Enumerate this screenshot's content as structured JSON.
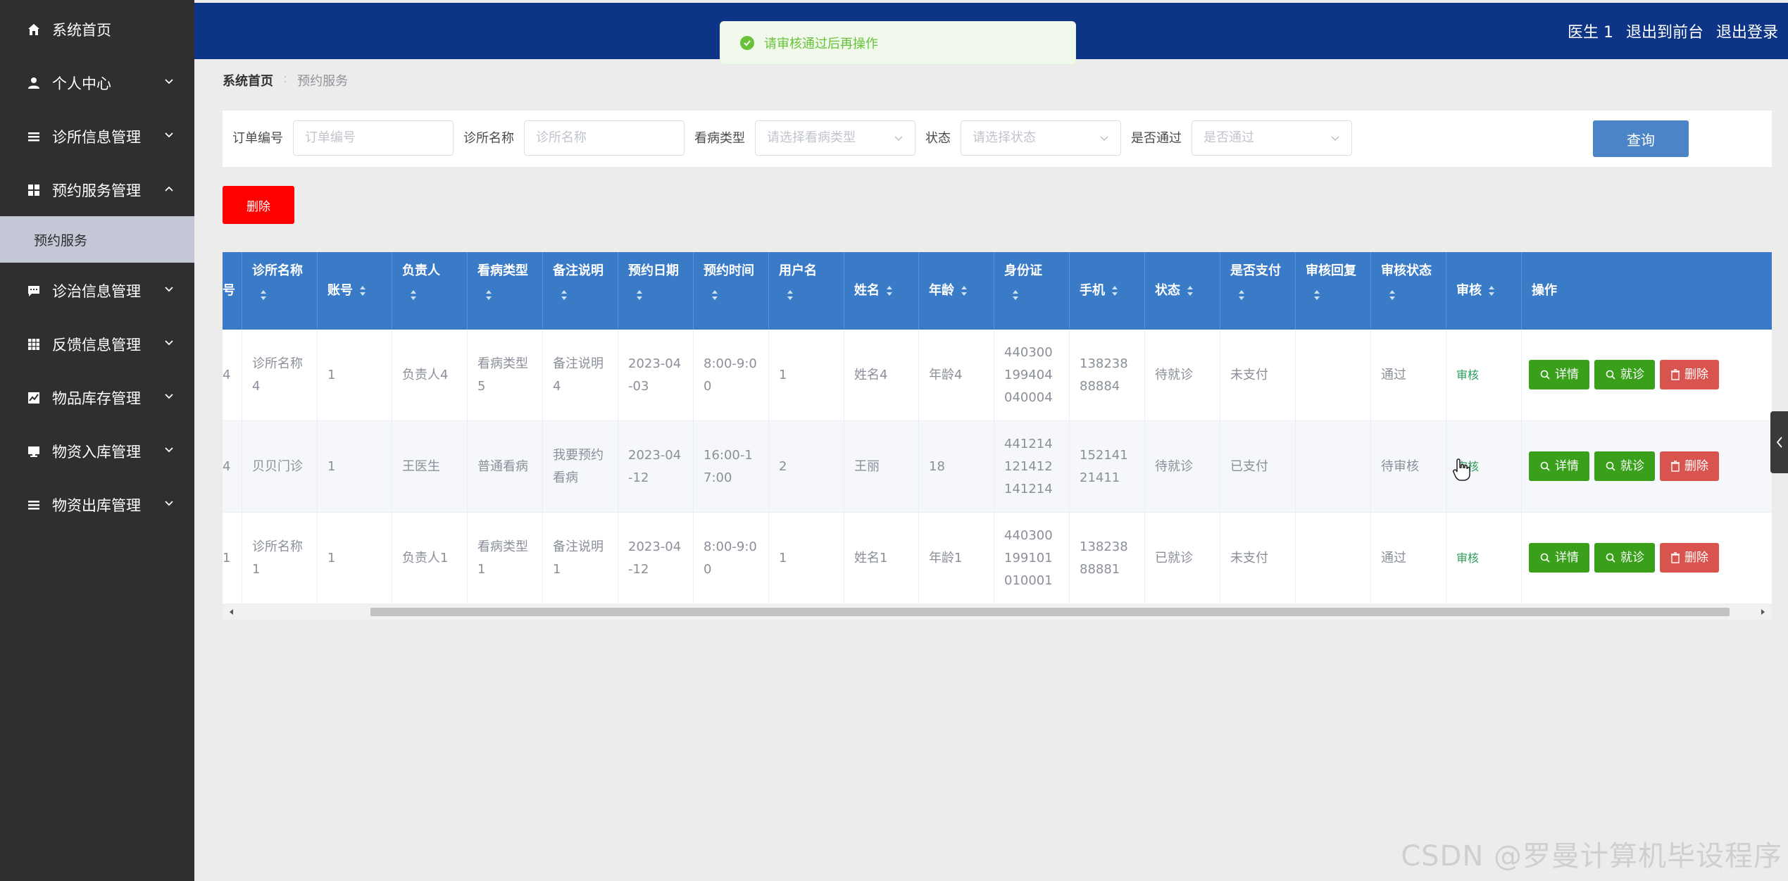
{
  "sidebar": {
    "items": [
      {
        "label": "系统首页",
        "icon": "home-icon"
      },
      {
        "label": "个人中心",
        "icon": "user-icon"
      },
      {
        "label": "诊所信息管理",
        "icon": "list-icon"
      },
      {
        "label": "预约服务管理",
        "icon": "grid-icon"
      },
      {
        "label": "诊治信息管理",
        "icon": "chat-icon"
      },
      {
        "label": "反馈信息管理",
        "icon": "table-icon"
      },
      {
        "label": "物品库存管理",
        "icon": "chart-icon"
      },
      {
        "label": "物资入库管理",
        "icon": "monitor-icon"
      },
      {
        "label": "物资出库管理",
        "icon": "list-icon"
      }
    ],
    "sub_item": "预约服务"
  },
  "topbar": {
    "user": "医生 1",
    "to_front": "退出到前台",
    "logout": "退出登录"
  },
  "toast": {
    "message": "请审核通过后再操作",
    "color": "#67c23a"
  },
  "breadcrumb": {
    "home": "系统首页",
    "current": "预约服务"
  },
  "filters": {
    "order_label": "订单编号",
    "order_placeholder": "订单编号",
    "clinic_label": "诊所名称",
    "clinic_placeholder": "诊所名称",
    "type_label": "看病类型",
    "type_placeholder": "请选择看病类型",
    "status_label": "状态",
    "status_placeholder": "请选择状态",
    "pass_label": "是否通过",
    "pass_placeholder": "是否通过",
    "query_button": "查询"
  },
  "delete_button": "删除",
  "table": {
    "headers": [
      "号",
      "诊所名称",
      "账号",
      "负责人",
      "看病类型",
      "备注说明",
      "预约日期",
      "预约时间",
      "用户名",
      "姓名",
      "年龄",
      "身份证",
      "手机",
      "状态",
      "是否支付",
      "审核回复",
      "审核状态",
      "审核",
      "操作"
    ],
    "rows": [
      [
        "4",
        "诊所名称4",
        "1",
        "负责人4",
        "看病类型5",
        "备注说明4",
        "2023-04-03",
        "8:00-9:00",
        "1",
        "姓名4",
        "年龄4",
        "440300199404040004",
        "13823888884",
        "待就诊",
        "未支付",
        "",
        "通过",
        "审核"
      ],
      [
        "4",
        "贝贝门诊",
        "1",
        "王医生",
        "普通看病",
        "我要预约看病",
        "2023-04-12",
        "16:00-17:00",
        "2",
        "王丽",
        "18",
        "441214121412141214",
        "15214121411",
        "待就诊",
        "已支付",
        "",
        "待审核",
        "审核"
      ],
      [
        "1",
        "诊所名称1",
        "1",
        "负责人1",
        "看病类型1",
        "备注说明1",
        "2023-04-12",
        "8:00-9:00",
        "1",
        "姓名1",
        "年龄1",
        "440300199101010001",
        "13823888881",
        "已就诊",
        "未支付",
        "",
        "通过",
        "审核"
      ]
    ],
    "actions": {
      "detail": "详情",
      "visit": "就诊",
      "delete": "删除"
    }
  },
  "colors": {
    "sidebar": "#2f2f2f",
    "topbar": "#0d3487",
    "table_header": "#3a7bc8",
    "green_button": "#3aa01c",
    "red_button": "#d9534f"
  },
  "watermark": "CSDN @罗曼计算机毕设程序"
}
